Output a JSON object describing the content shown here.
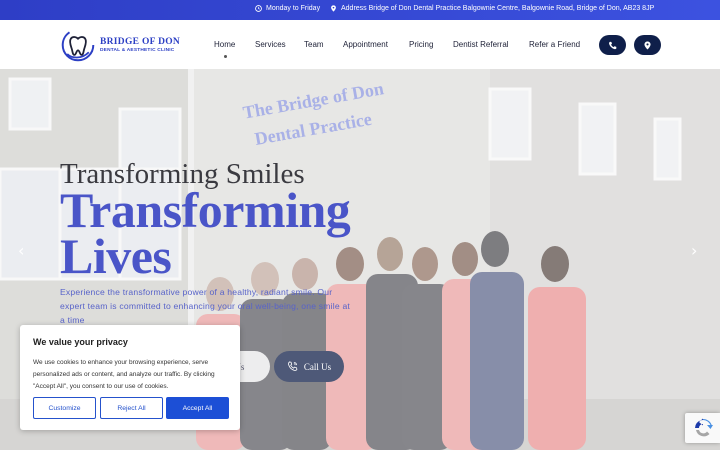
{
  "topbar": {
    "hours": "Monday to Friday",
    "address": "Address Bridge of Don Dental Practice Balgownie Centre, Balgownie Road, Bridge of Don, AB23 8JP"
  },
  "logo": {
    "title": "BRIDGE OF DON",
    "subtitle": "DENTAL & AESTHETIC CLINIC"
  },
  "nav": {
    "items": [
      "Home",
      "Services",
      "Team",
      "Appointment",
      "Pricing",
      "Dentist Referral",
      "Refer a Friend"
    ],
    "active": "Home"
  },
  "building_sign": "The Bridge of Don Dental Practice",
  "hero": {
    "pre_title": "Transforming Smiles",
    "title_line1": "Transforming",
    "title_line2": "Lives",
    "description": "Experience the transformative power of a healthy, radiant smile. Our expert team is committed to enhancing your oral well-being, one smile at a time",
    "contact_label": "ct Us",
    "call_label": "Call Us"
  },
  "cookie": {
    "title": "We value your privacy",
    "text": "We use cookies to enhance your browsing experience, serve personalized ads or content, and analyze our traffic. By clicking \"Accept All\", you consent to our use of cookies.",
    "customize": "Customize",
    "reject": "Reject All",
    "accept": "Accept All"
  },
  "colors": {
    "brand": "#2e3ec6",
    "dark_button": "#0f1f4a",
    "accept": "#1c4fd6"
  }
}
